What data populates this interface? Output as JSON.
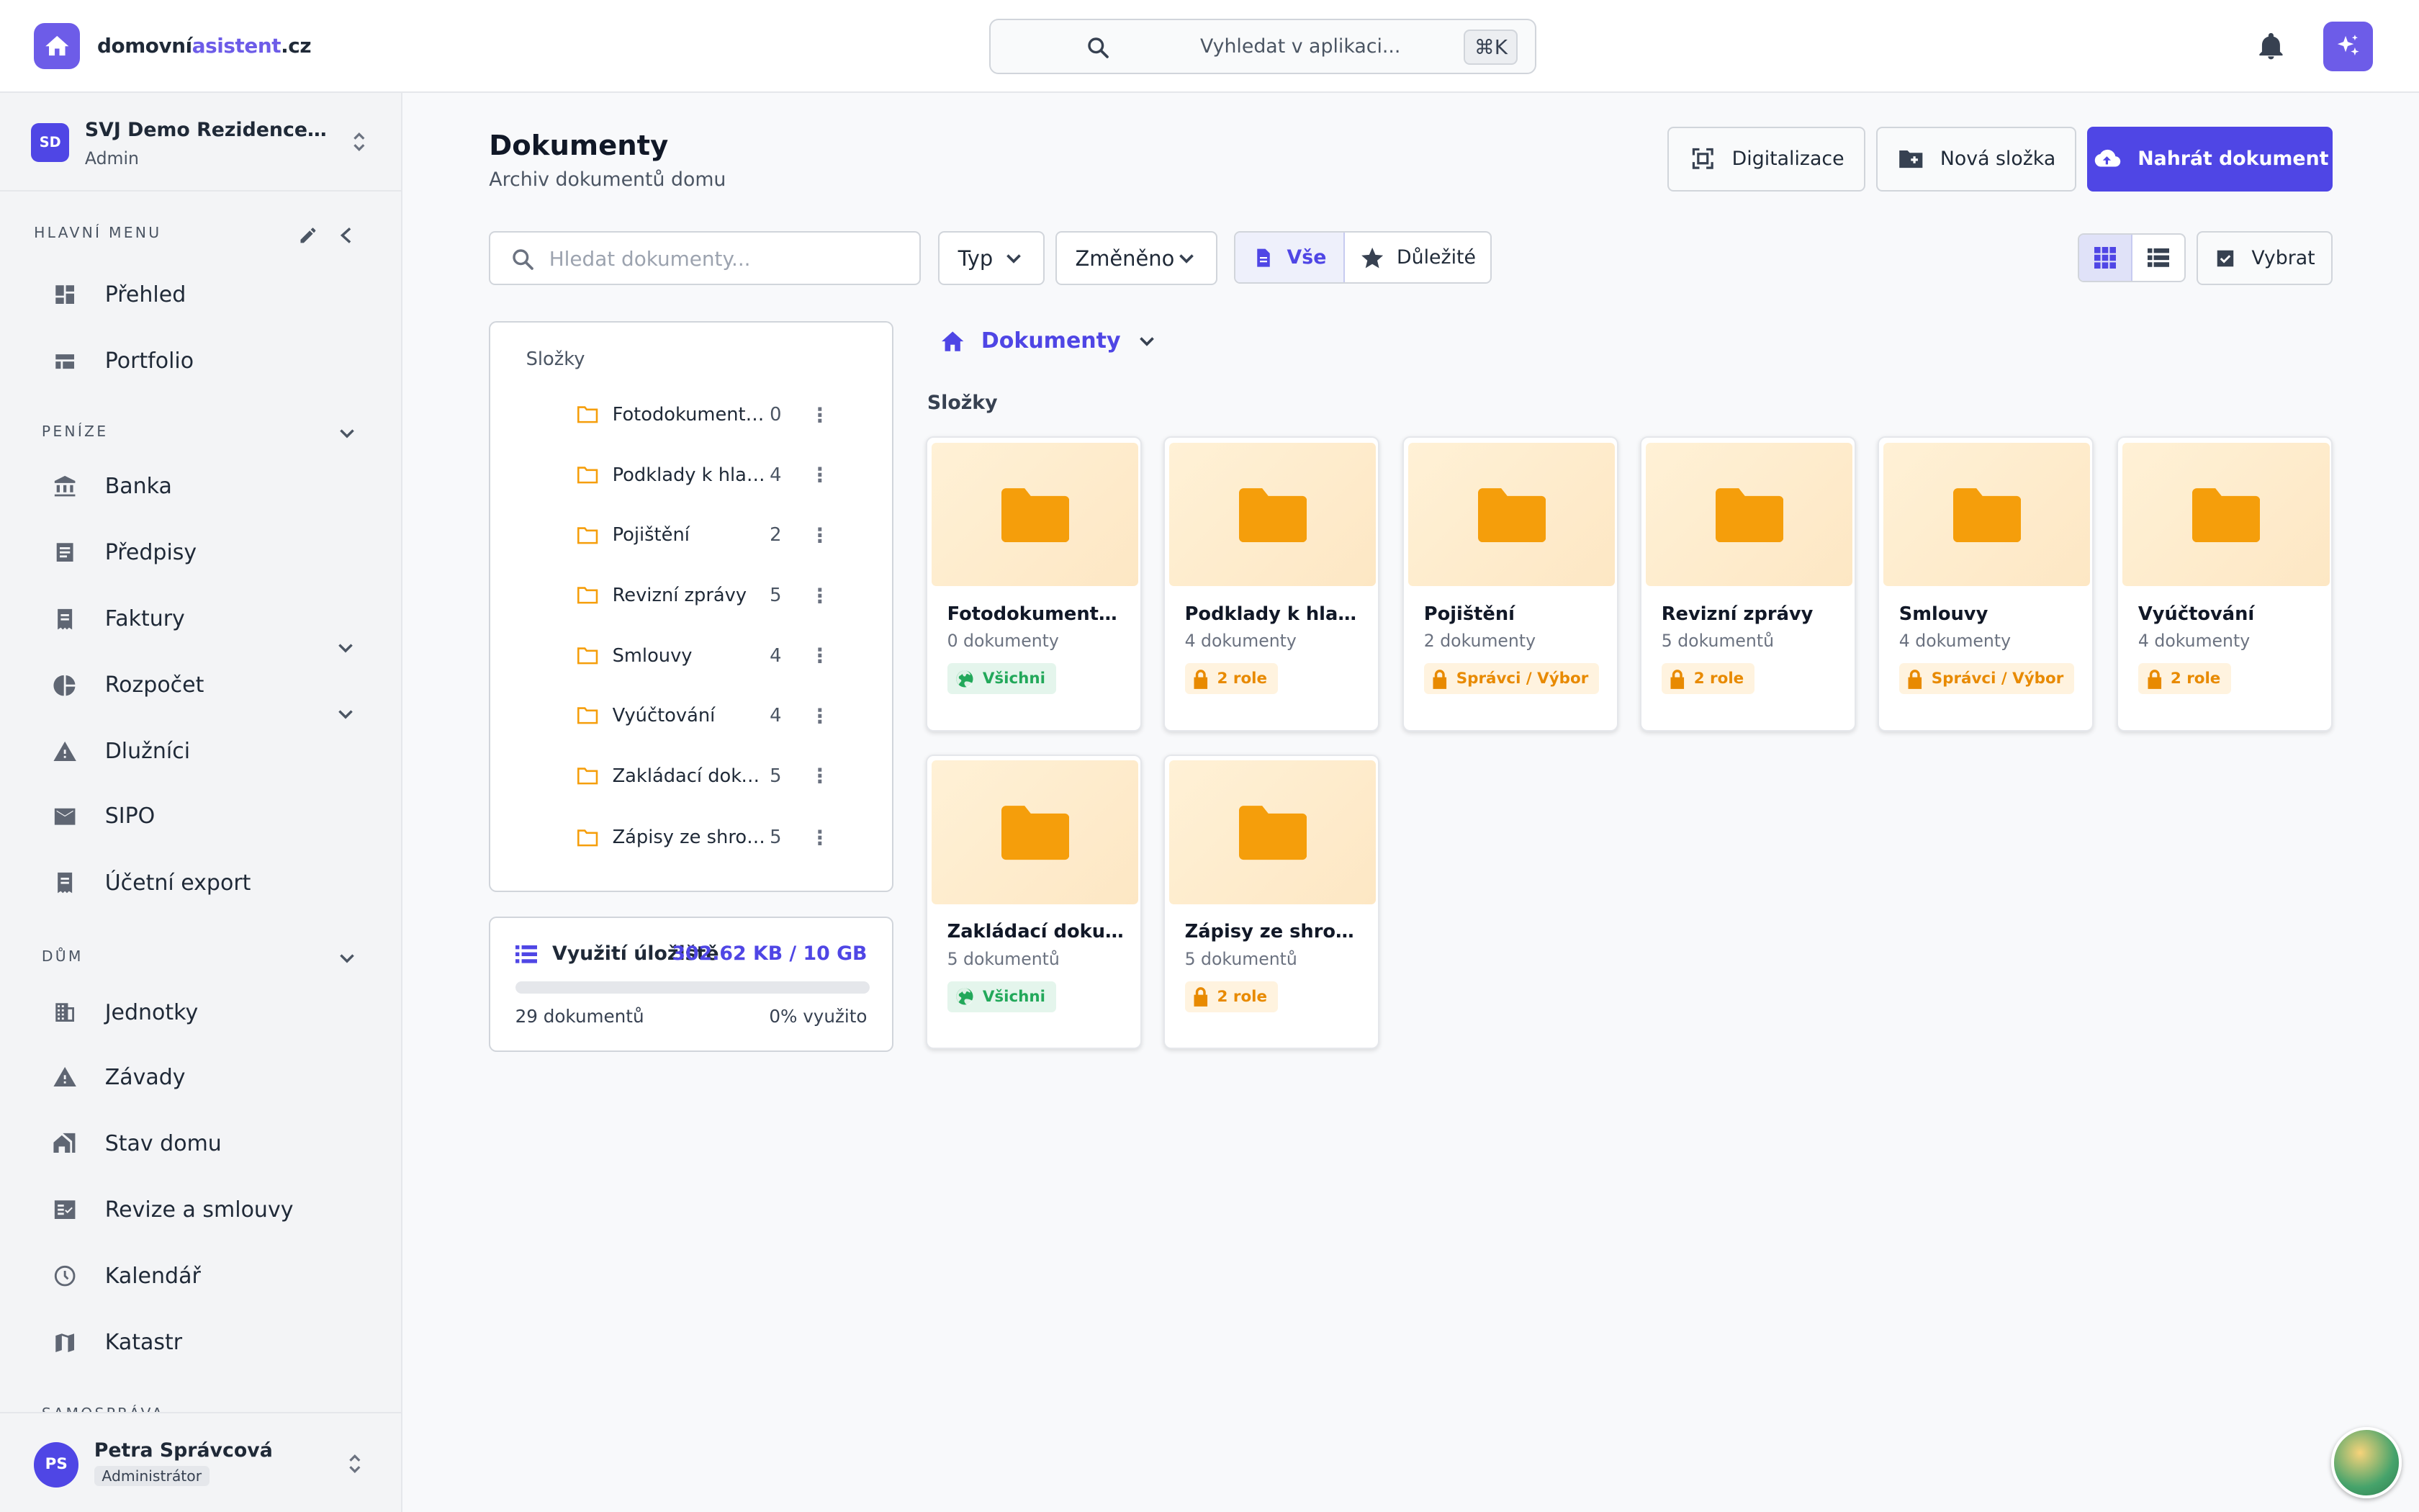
{
  "app": {
    "logo_part1": "domovní",
    "logo_part2": "asistent",
    "logo_part3": ".cz"
  },
  "search": {
    "placeholder": "Vyhledat v aplikaci...",
    "shortcut": "⌘K"
  },
  "org": {
    "initials": "SD",
    "name": "SVJ Demo Rezidence Vltava",
    "role": "Admin"
  },
  "sidebar": {
    "sections": {
      "main": "HLAVNÍ MENU",
      "money": "PENÍZE",
      "house": "DŮM",
      "gov": "SAMOSPRÁVA"
    },
    "items": [
      {
        "label": "Přehled"
      },
      {
        "label": "Portfolio"
      },
      {
        "label": "Banka"
      },
      {
        "label": "Předpisy"
      },
      {
        "label": "Faktury"
      },
      {
        "label": "Rozpočet"
      },
      {
        "label": "Dlužníci"
      },
      {
        "label": "SIPO"
      },
      {
        "label": "Účetní export"
      },
      {
        "label": "Jednotky"
      },
      {
        "label": "Závady"
      },
      {
        "label": "Stav domu"
      },
      {
        "label": "Revize a smlouvy"
      },
      {
        "label": "Kalendář"
      },
      {
        "label": "Katastr"
      }
    ]
  },
  "user": {
    "initials": "PS",
    "name": "Petra Správcová",
    "role": "Administrátor"
  },
  "page": {
    "title": "Dokumenty",
    "subtitle": "Archiv dokumentů domu"
  },
  "actions": {
    "digitize": "Digitalizace",
    "new_folder": "Nová složka",
    "upload": "Nahrát dokument"
  },
  "filters": {
    "search_placeholder": "Hledat dokumenty...",
    "type": "Typ",
    "changed": "Změněno",
    "all": "Vše",
    "important": "Důležité",
    "select": "Vybrat"
  },
  "tree": {
    "title": "Složky",
    "folders": [
      {
        "name": "Fotodokumentace",
        "count": "0"
      },
      {
        "name": "Podklady k hlasování",
        "count": "4"
      },
      {
        "name": "Pojištění",
        "count": "2"
      },
      {
        "name": "Revizní zprávy",
        "count": "5"
      },
      {
        "name": "Smlouvy",
        "count": "4"
      },
      {
        "name": "Vyúčtování",
        "count": "4"
      },
      {
        "name": "Zakládací dokumenty",
        "count": "5"
      },
      {
        "name": "Zápisy ze shromáždění",
        "count": "5"
      }
    ]
  },
  "storage": {
    "title": "Využití úložiště",
    "value": "302.62 KB / 10 GB",
    "count": "29 dokumentů",
    "percent": "0% využito",
    "fill_fraction": 0.0
  },
  "breadcrumb": {
    "label": "Dokumenty"
  },
  "grid": {
    "heading": "Složky",
    "cards": [
      {
        "name": "Fotodokumentace",
        "count": "0 dokumenty",
        "badge": "Všichni",
        "badge_type": "public"
      },
      {
        "name": "Podklady k hlasování",
        "count": "4 dokumenty",
        "badge": "2 role",
        "badge_type": "restricted"
      },
      {
        "name": "Pojištění",
        "count": "2 dokumenty",
        "badge": "Správci / Výbor",
        "badge_type": "restricted"
      },
      {
        "name": "Revizní zprávy",
        "count": "5 dokumentů",
        "badge": "2 role",
        "badge_type": "restricted"
      },
      {
        "name": "Smlouvy",
        "count": "4 dokumenty",
        "badge": "Správci / Výbor",
        "badge_type": "restricted"
      },
      {
        "name": "Vyúčtování",
        "count": "4 dokumenty",
        "badge": "2 role",
        "badge_type": "restricted"
      },
      {
        "name": "Zakládací dokumenty",
        "count": "5 dokumentů",
        "badge": "Všichni",
        "badge_type": "public"
      },
      {
        "name": "Zápisy ze shromáždění",
        "count": "5 dokumentů",
        "badge": "2 role",
        "badge_type": "restricted"
      }
    ]
  },
  "colors": {
    "accent": "#4f46e5",
    "brand": "#6d5ce8",
    "folder": "#f59e0b",
    "public": "#22a85a",
    "restricted": "#e88a00"
  }
}
